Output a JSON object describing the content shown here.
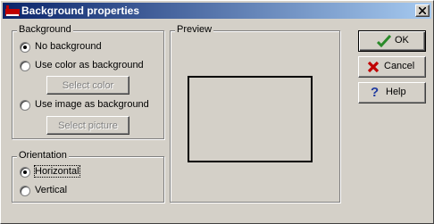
{
  "window": {
    "title": "Background properties",
    "titlebar_colors": [
      "#0a246a",
      "#a6caf0"
    ],
    "close_icon": "close-icon",
    "app_icon": "window-app-icon"
  },
  "background_group": {
    "label": "Background",
    "options": [
      {
        "label": "No background",
        "checked": true
      },
      {
        "label": "Use color as background",
        "checked": false
      },
      {
        "label": "Use image as background",
        "checked": false
      }
    ],
    "select_color_label": "Select color",
    "select_picture_label": "Select picture"
  },
  "orientation_group": {
    "label": "Orientation",
    "options": [
      {
        "label": "Horizontal",
        "checked": true,
        "focused": true
      },
      {
        "label": "Vertical",
        "checked": false
      }
    ]
  },
  "preview_group": {
    "label": "Preview"
  },
  "buttons": {
    "ok": {
      "label": "OK",
      "icon": "checkmark-icon",
      "icon_color": "#2a8a2a"
    },
    "cancel": {
      "label": "Cancel",
      "icon": "red-x-icon",
      "icon_color": "#c00000"
    },
    "help": {
      "label": "Help",
      "icon": "question-mark-icon",
      "icon_color": "#1f3aa0"
    }
  }
}
